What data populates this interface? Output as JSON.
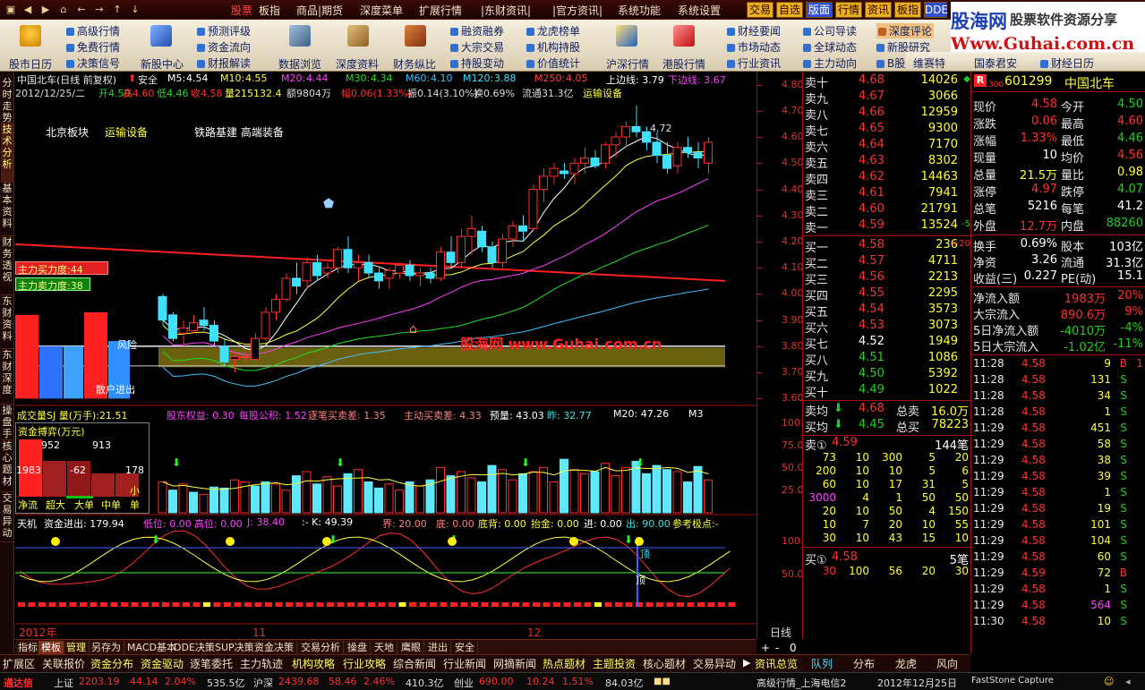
{
  "menu": {
    "labels": [
      "股票",
      "板指",
      "商品|期货",
      "深度菜单",
      "扩展行情",
      "|东财资讯|",
      "|官方资讯|",
      "系统功能",
      "系统设置"
    ],
    "right_buttons": [
      "交易",
      "自选",
      "版面",
      "行情",
      "资讯",
      "板指",
      "DDE"
    ]
  },
  "brand": {
    "cn": "股海网",
    "cn_sub": "股票软件资源分享",
    "url": "Www.Guhai.com.cn"
  },
  "toolbar": {
    "big": [
      {
        "label": "股市日历"
      },
      {
        "label": "新股中心"
      },
      {
        "label": "数据浏览"
      },
      {
        "label": "深度资料"
      },
      {
        "label": "财务纵比"
      },
      {
        "label": "沪深行情"
      },
      {
        "label": "港股行情"
      }
    ],
    "col1": [
      "高级行情",
      "免费行情",
      "决策信号"
    ],
    "col2": [
      "预测评级",
      "资金流向",
      "财报解读"
    ],
    "col3": [
      "融资融券",
      "大宗交易",
      "持股变动"
    ],
    "col4": [
      "龙虎榜单",
      "机构持股",
      "价值统计"
    ],
    "col5": [
      "财经要闻",
      "市场动态",
      "行业资讯"
    ],
    "col6": [
      "公司导读",
      "全球动态",
      "主力动向"
    ],
    "col7": [
      "深度评论",
      "新股研究",
      "B股资讯"
    ],
    "col8": [
      "维赛特",
      "国泰君安",
      "财经日历"
    ]
  },
  "left_tabs": [
    "分时走势",
    "技术分析",
    "基本资料",
    "财务透视",
    "东财资料",
    "东财深度",
    "操盘手",
    "核心题材",
    "交易异动"
  ],
  "main_chart": {
    "title_line": "中国北车(日线 前复权)",
    "safety": "安全",
    "ma": [
      {
        "name": "M5:",
        "value": "4.54"
      },
      {
        "name": "M10:",
        "value": "4.55"
      },
      {
        "name": "M20:",
        "value": "4.44"
      },
      {
        "name": "M30:",
        "value": "4.34"
      },
      {
        "name": "M60:",
        "value": "4.10"
      },
      {
        "name": "M120:",
        "value": "3.88"
      },
      {
        "name": "M250:",
        "value": "4.05"
      }
    ],
    "upper": "上边线: 3.79",
    "lower": "下边线: 3.67",
    "info": {
      "date": "2012/12/25/二",
      "open": "开4.50",
      "high": "高4.60",
      "low": "低4.46",
      "close": "收4.58",
      "vol": "量215132.4",
      "amount": "额9804万",
      "range": "幅0.06(1.33%)",
      "amp": "振0.14(3.10%)",
      "turn": "换0.69%",
      "float": "流通31.3亿",
      "sector": "运输设备"
    },
    "tags": [
      "北京板块",
      "运输设备",
      "铁路基建 高端装备"
    ],
    "buy_power": "主力买力度:44",
    "sell_power": "主力卖力度:38",
    "bar_labels": [
      "风险",
      "散户进出"
    ],
    "max_label": "4.72",
    "watermark": "股海网 www.Guhai.com.cn"
  },
  "vol_panel": {
    "title": "成交量SJ 量(万手):21.51",
    "items": [
      {
        "t": "股东权益: 0.30",
        "c": "#ff40ff"
      },
      {
        "t": "每股公积: 1.52",
        "c": "#ff40ff"
      },
      {
        "t": "逐笔买卖差: 1.35",
        "c": "#ff8080"
      },
      {
        "t": "主动买卖差: 4.33",
        "c": "#ff8080"
      },
      {
        "t": "预量: 43.03",
        "c": "#ffffff"
      },
      {
        "t": "昨: 32.77",
        "c": "#40e0e0"
      },
      {
        "t": "M20: 47.26",
        "c": "#ffffff"
      },
      {
        "t": "M3",
        "c": "#ffffff"
      }
    ],
    "box_title": "资金搏弈(万元)",
    "box_vals": [
      "952",
      "913",
      "1983",
      "-62",
      "178"
    ],
    "box_legend": [
      "净流",
      "超大",
      "大单",
      "中单",
      "小单"
    ],
    "axis": [
      "100.0",
      "75.00",
      "50.00",
      "25.00"
    ]
  },
  "timing_panel": {
    "items": [
      {
        "t": "天机",
        "c": "#ffffff"
      },
      {
        "t": "资金进出: 179.94",
        "c": "#ffffff"
      },
      {
        "t": "低位: 0.00",
        "c": "#ff40ff"
      },
      {
        "t": "高位: 0.00",
        "c": "#ff40ff"
      },
      {
        "t": "J: 38.40",
        "c": "#ff40ff"
      },
      {
        "t": ":- K: 49.39",
        "c": "#ffffff"
      },
      {
        "t": "界: 20.00",
        "c": "#ff8080"
      },
      {
        "t": "底: 0.00",
        "c": "#ff8080"
      },
      {
        "t": "底背: 0.00",
        "c": "#ffff30"
      },
      {
        "t": "抬金: 0.00",
        "c": "#ffff30"
      },
      {
        "t": "进: 0.00",
        "c": "#ffffff"
      },
      {
        "t": "出: 90.00",
        "c": "#40e0e0"
      },
      {
        "t": "参考极点:-",
        "c": "#ffff30"
      }
    ],
    "axis": [
      "100.0",
      "50.00"
    ],
    "marks": [
      "顶",
      "顶"
    ]
  },
  "x_axis": {
    "labels": [
      "2012年",
      "11",
      "12"
    ],
    "period": "日线"
  },
  "price_axis": [
    "4.80",
    "4.70",
    "4.60",
    "4.50",
    "4.40",
    "4.30",
    "4.20",
    "4.10",
    "4.00",
    "3.90",
    "3.80",
    "3.70",
    "3.60"
  ],
  "chart_data": {
    "type": "line",
    "title": "中国北车(日线 前复权)",
    "candles": [
      [
        3.99,
        4.0,
        3.88,
        3.9
      ],
      [
        3.92,
        3.93,
        3.82,
        3.83
      ],
      [
        3.85,
        3.9,
        3.8,
        3.87
      ],
      [
        3.86,
        3.92,
        3.85,
        3.89
      ],
      [
        3.9,
        3.95,
        3.86,
        3.88
      ],
      [
        3.88,
        3.9,
        3.8,
        3.82
      ],
      [
        3.8,
        3.83,
        3.72,
        3.74
      ],
      [
        3.75,
        3.78,
        3.7,
        3.76
      ],
      [
        3.76,
        3.78,
        3.74,
        3.76
      ],
      [
        3.75,
        3.85,
        3.74,
        3.83
      ],
      [
        3.83,
        3.95,
        3.82,
        3.93
      ],
      [
        3.93,
        4.0,
        3.9,
        3.98
      ],
      [
        3.98,
        4.08,
        3.97,
        4.06
      ],
      [
        4.06,
        4.12,
        4.0,
        4.03
      ],
      [
        4.05,
        4.14,
        4.02,
        4.12
      ],
      [
        4.12,
        4.15,
        4.05,
        4.07
      ],
      [
        4.08,
        4.12,
        4.06,
        4.1
      ],
      [
        4.1,
        4.18,
        4.08,
        4.17
      ],
      [
        4.17,
        4.22,
        4.08,
        4.1
      ],
      [
        4.1,
        4.15,
        4.05,
        4.12
      ],
      [
        4.12,
        4.15,
        4.06,
        4.08
      ],
      [
        4.08,
        4.1,
        4.02,
        4.05
      ],
      [
        4.06,
        4.1,
        4.02,
        4.09
      ],
      [
        4.08,
        4.12,
        4.06,
        4.11
      ],
      [
        4.11,
        4.13,
        4.05,
        4.07
      ],
      [
        4.07,
        4.1,
        4.03,
        4.08
      ],
      [
        4.08,
        4.1,
        4.04,
        4.06
      ],
      [
        4.06,
        4.18,
        4.05,
        4.16
      ],
      [
        4.16,
        4.22,
        4.1,
        4.12
      ],
      [
        4.12,
        4.25,
        4.1,
        4.22
      ],
      [
        4.22,
        4.3,
        4.15,
        4.25
      ],
      [
        4.24,
        4.26,
        4.16,
        4.18
      ],
      [
        4.18,
        4.2,
        4.1,
        4.12
      ],
      [
        4.12,
        4.23,
        4.1,
        4.21
      ],
      [
        4.21,
        4.28,
        4.18,
        4.26
      ],
      [
        4.26,
        4.3,
        4.2,
        4.24
      ],
      [
        4.25,
        4.42,
        4.24,
        4.4
      ],
      [
        4.4,
        4.48,
        4.35,
        4.45
      ],
      [
        4.45,
        4.5,
        4.42,
        4.48
      ],
      [
        4.47,
        4.5,
        4.44,
        4.46
      ],
      [
        4.46,
        4.52,
        4.42,
        4.5
      ],
      [
        4.5,
        4.56,
        4.46,
        4.52
      ],
      [
        4.52,
        4.55,
        4.48,
        4.49
      ],
      [
        4.5,
        4.58,
        4.48,
        4.57
      ],
      [
        4.57,
        4.62,
        4.52,
        4.6
      ],
      [
        4.6,
        4.66,
        4.56,
        4.64
      ],
      [
        4.64,
        4.72,
        4.6,
        4.62
      ],
      [
        4.62,
        4.64,
        4.55,
        4.58
      ],
      [
        4.58,
        4.62,
        4.5,
        4.53
      ],
      [
        4.53,
        4.58,
        4.46,
        4.48
      ],
      [
        4.49,
        4.58,
        4.46,
        4.56
      ],
      [
        4.56,
        4.6,
        4.52,
        4.54
      ],
      [
        4.54,
        4.58,
        4.48,
        4.52
      ],
      [
        4.5,
        4.6,
        4.46,
        4.58
      ]
    ],
    "ylim": [
      3.55,
      4.85
    ],
    "volume": [
      30,
      22,
      28,
      20,
      18,
      25,
      24,
      32,
      30,
      26,
      30,
      28,
      22,
      36,
      40,
      28,
      35,
      26,
      38,
      42,
      30,
      24,
      28,
      22,
      30,
      26,
      32,
      44,
      36,
      40,
      34,
      30,
      46,
      42,
      32,
      38,
      40,
      44,
      30,
      52,
      42,
      38,
      40,
      48,
      36,
      44,
      50,
      38,
      46,
      42,
      40,
      30,
      45,
      32
    ],
    "vol_colors": [
      "r",
      "c",
      "r",
      "c",
      "r",
      "c",
      "c",
      "r",
      "r",
      "c",
      "c",
      "r",
      "r",
      "c",
      "r",
      "c",
      "r",
      "r",
      "c",
      "r",
      "c",
      "c",
      "r",
      "r",
      "c",
      "r",
      "c",
      "r",
      "c",
      "r",
      "r",
      "c",
      "c",
      "r",
      "r",
      "c",
      "r",
      "r",
      "r",
      "c",
      "r",
      "r",
      "c",
      "r",
      "r",
      "r",
      "c",
      "c",
      "c",
      "c",
      "r",
      "c",
      "c",
      "r"
    ]
  },
  "orderbook": {
    "sell": [
      {
        "l": "卖十",
        "p": "4.68",
        "v": "14026",
        "d": "◆"
      },
      {
        "l": "卖九",
        "p": "4.67",
        "v": "3066",
        "d": ""
      },
      {
        "l": "卖八",
        "p": "4.66",
        "v": "12959",
        "d": ""
      },
      {
        "l": "卖七",
        "p": "4.65",
        "v": "9300",
        "d": ""
      },
      {
        "l": "卖六",
        "p": "4.64",
        "v": "7170",
        "d": ""
      },
      {
        "l": "卖五",
        "p": "4.63",
        "v": "8302",
        "d": ""
      },
      {
        "l": "卖四",
        "p": "4.62",
        "v": "14463",
        "d": ""
      },
      {
        "l": "卖三",
        "p": "4.61",
        "v": "7941",
        "d": ""
      },
      {
        "l": "卖二",
        "p": "4.60",
        "v": "21791",
        "d": ""
      },
      {
        "l": "卖一",
        "p": "4.59",
        "v": "13524",
        "d": "-5"
      }
    ],
    "buy": [
      {
        "l": "买一",
        "p": "4.58",
        "v": "236",
        "d": "+20"
      },
      {
        "l": "买二",
        "p": "4.57",
        "v": "4711",
        "d": ""
      },
      {
        "l": "买三",
        "p": "4.56",
        "v": "2213",
        "d": ""
      },
      {
        "l": "买四",
        "p": "4.55",
        "v": "2295",
        "d": ""
      },
      {
        "l": "买五",
        "p": "4.54",
        "v": "3573",
        "d": ""
      },
      {
        "l": "买六",
        "p": "4.53",
        "v": "3073",
        "d": ""
      },
      {
        "l": "买七",
        "p": "4.52",
        "v": "1949",
        "d": ""
      },
      {
        "l": "买八",
        "p": "4.51",
        "v": "1086",
        "d": ""
      },
      {
        "l": "买九",
        "p": "4.50",
        "v": "5392",
        "d": ""
      },
      {
        "l": "买十",
        "p": "4.49",
        "v": "1022",
        "d": ""
      }
    ],
    "avg_sell": {
      "l": "卖均",
      "p": "4.68",
      "t": "总卖",
      "v": "16.0万"
    },
    "avg_buy": {
      "l": "买均",
      "p": "4.45",
      "t": "总买",
      "v": "78223"
    },
    "sell1_q": {
      "l": "卖①",
      "p": "4.59",
      "v": "144笔"
    },
    "queue": [
      [
        "73",
        "10",
        "300",
        "5",
        "20"
      ],
      [
        "200",
        "10",
        "10",
        "5",
        "6"
      ],
      [
        "60",
        "10",
        "17",
        "31",
        "5"
      ],
      [
        "3000",
        "4",
        "1",
        "50",
        "50"
      ],
      [
        "20",
        "10",
        "50",
        "4",
        "150"
      ],
      [
        "10",
        "7",
        "20",
        "10",
        "55"
      ],
      [
        "30",
        "10",
        "43",
        "15",
        "10"
      ]
    ],
    "buy1_q": {
      "l": "买①",
      "p": "4.58",
      "v": "5笔"
    },
    "buy1_queue": [
      "30",
      "100",
      "56",
      "20",
      "30"
    ]
  },
  "quote": {
    "badge": "R",
    "market": "300",
    "code": "601299",
    "name": "中国北车",
    "rows": [
      [
        {
          "l": "现价",
          "v": "4.58",
          "c": "red"
        },
        {
          "l": "今开",
          "v": "4.50",
          "c": "grn"
        }
      ],
      [
        {
          "l": "涨跌",
          "v": "0.06",
          "c": "red"
        },
        {
          "l": "最高",
          "v": "4.60",
          "c": "red"
        }
      ],
      [
        {
          "l": "涨幅",
          "v": "1.33%",
          "c": "red"
        },
        {
          "l": "最低",
          "v": "4.46",
          "c": "grn"
        }
      ],
      [
        {
          "l": "现量",
          "v": "10",
          "c": "wht"
        },
        {
          "l": "均价",
          "v": "4.56",
          "c": "red"
        }
      ],
      [
        {
          "l": "总量",
          "v": "21.5万",
          "c": "yel"
        },
        {
          "l": "量比",
          "v": "0.98",
          "c": "yel"
        }
      ],
      [
        {
          "l": "涨停",
          "v": "4.97",
          "c": "red"
        },
        {
          "l": "跌停",
          "v": "4.07",
          "c": "grn"
        }
      ],
      [
        {
          "l": "总笔",
          "v": "5216",
          "c": "wht"
        },
        {
          "l": "每笔",
          "v": "41.2",
          "c": "wht"
        }
      ],
      [
        {
          "l": "外盘",
          "v": "12.7万",
          "c": "red"
        },
        {
          "l": "内盘",
          "v": "88260",
          "c": "grn"
        }
      ]
    ],
    "rows2": [
      [
        {
          "l": "换手",
          "v": "0.69%",
          "c": "wht"
        },
        {
          "l": "股本",
          "v": "103亿",
          "c": "wht"
        }
      ],
      [
        {
          "l": "净资",
          "v": "3.26",
          "c": "wht"
        },
        {
          "l": "流通",
          "v": "31.3亿",
          "c": "wht"
        }
      ],
      [
        {
          "l": "收益(三)",
          "v": "0.227",
          "c": "wht"
        },
        {
          "l": "PE(动)",
          "v": "15.1",
          "c": "wht"
        }
      ]
    ],
    "flows": [
      {
        "l": "净流入额",
        "v": "1983万",
        "p": "20%",
        "c": "red"
      },
      {
        "l": "大宗流入",
        "v": "890.6万",
        "p": "9%",
        "c": "red"
      },
      {
        "l": "5日净流入额",
        "v": "-4010万",
        "p": "-4%",
        "c": "grn"
      },
      {
        "l": "5日大宗流入",
        "v": "-1.02亿",
        "p": "-11%",
        "c": "grn"
      }
    ],
    "ticks": [
      {
        "t": "11:28",
        "p": "4.58",
        "v": "9",
        "d": "B",
        "c": "red",
        "vc": "yel"
      },
      {
        "t": "11:28",
        "p": "4.58",
        "v": "131",
        "d": "S",
        "c": "grn",
        "vc": "yel"
      },
      {
        "t": "11:28",
        "p": "4.58",
        "v": "34",
        "d": "S",
        "c": "grn",
        "vc": "yel"
      },
      {
        "t": "11:28",
        "p": "4.58",
        "v": "1",
        "d": "S",
        "c": "grn",
        "vc": "yel"
      },
      {
        "t": "11:29",
        "p": "4.58",
        "v": "451",
        "d": "S",
        "c": "grn",
        "vc": "yel"
      },
      {
        "t": "11:29",
        "p": "4.58",
        "v": "58",
        "d": "S",
        "c": "grn",
        "vc": "yel"
      },
      {
        "t": "11:29",
        "p": "4.58",
        "v": "38",
        "d": "S",
        "c": "grn",
        "vc": "yel"
      },
      {
        "t": "11:29",
        "p": "4.58",
        "v": "39",
        "d": "S",
        "c": "grn",
        "vc": "yel"
      },
      {
        "t": "11:29",
        "p": "4.58",
        "v": "1",
        "d": "S",
        "c": "grn",
        "vc": "yel"
      },
      {
        "t": "11:29",
        "p": "4.58",
        "v": "19",
        "d": "S",
        "c": "grn",
        "vc": "yel"
      },
      {
        "t": "11:29",
        "p": "4.58",
        "v": "101",
        "d": "S",
        "c": "grn",
        "vc": "yel"
      },
      {
        "t": "11:29",
        "p": "4.58",
        "v": "104",
        "d": "S",
        "c": "grn",
        "vc": "yel"
      },
      {
        "t": "11:29",
        "p": "4.58",
        "v": "60",
        "d": "S",
        "c": "grn",
        "vc": "yel"
      },
      {
        "t": "11:29",
        "p": "4.59",
        "v": "72",
        "d": "B",
        "c": "red",
        "vc": "yel"
      },
      {
        "t": "11:29",
        "p": "4.58",
        "v": "1",
        "d": "S",
        "c": "grn",
        "vc": "yel"
      },
      {
        "t": "11:29",
        "p": "4.58",
        "v": "564",
        "d": "S",
        "c": "grn",
        "vc": "mag"
      },
      {
        "t": "11:30",
        "p": "4.58",
        "v": "10",
        "d": "S",
        "c": "grn",
        "vc": "yel"
      }
    ],
    "edge": "1"
  },
  "btabs1": [
    "指标",
    "模板",
    "管理",
    "另存为",
    "MACD基本",
    "DDE决策",
    "SUP决策",
    "资金决策",
    "交易分析",
    "操盘",
    "天地",
    "鹰眼",
    "进出",
    "安全"
  ],
  "btabs1_right": [
    "+",
    "-",
    "0"
  ],
  "btabs2": [
    "扩展区",
    "关联报价",
    "资金分布",
    "资金驱动",
    "逐笔委托",
    "主力轨迹",
    "机构攻略",
    "行业攻略",
    "综合新闻",
    "行业新闻",
    "网摘新闻",
    "热点题材",
    "主题投资",
    "核心题材",
    "交易异动",
    "资讯总览"
  ],
  "btabs2_right": [
    "队列",
    "分布",
    "龙虎",
    "风向"
  ],
  "status": {
    "app": "通达信",
    "sh": "上证",
    "sh_v": "2203.19",
    "sh_c": "44.14",
    "sh_p": "2.04%",
    "sh_a": "535.5亿",
    "sz": "沪深",
    "sz_v": "2439.68",
    "sz_c": "58.46",
    "sz_p": "2.46%",
    "sz_a": "410.3亿",
    "cy": "创业",
    "cy_v": "690.00",
    "cy_c": "10.24",
    "cy_p": "1.51%",
    "cy_a": "84.03亿",
    "server": "高级行情_上海电信2",
    "date": "2012年12月25日",
    "fsc": "FastStone Capture"
  }
}
